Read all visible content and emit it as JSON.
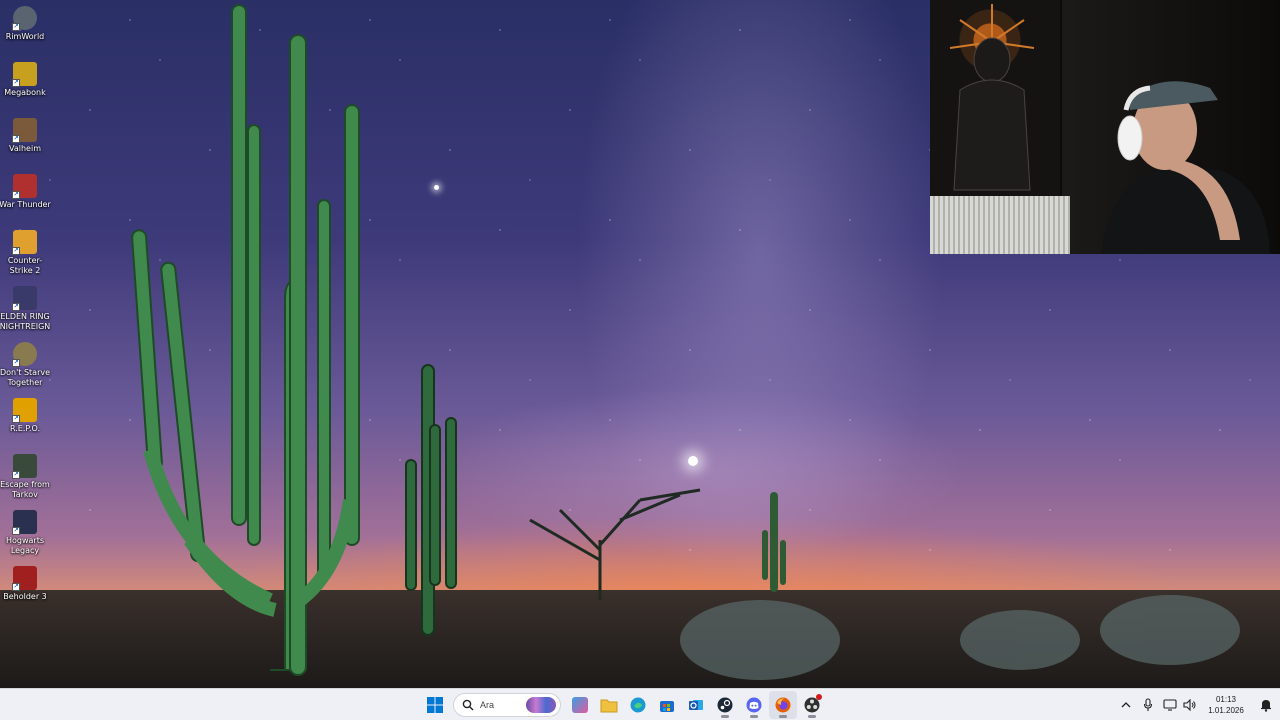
{
  "desktop": {
    "icons": [
      {
        "label": "RimWorld",
        "icon": "rimworld-icon",
        "color": "#5a6470"
      },
      {
        "label": "Megabonk",
        "icon": "megabonk-icon",
        "color": "#c8a020"
      },
      {
        "label": "Valheim",
        "icon": "valheim-icon",
        "color": "#7a5a3a"
      },
      {
        "label": "War Thunder",
        "icon": "war-thunder-icon",
        "color": "#b03030"
      },
      {
        "label": "Counter-Strike 2",
        "icon": "counter-strike-2-icon",
        "color": "#e0a030"
      },
      {
        "label": "ELDEN RING NIGHTREIGN",
        "icon": "elden-ring-nightreign-icon",
        "color": "#3a3a6a"
      },
      {
        "label": "Don't Starve Together",
        "icon": "dont-starve-together-icon",
        "color": "#8a7a50"
      },
      {
        "label": "R.E.P.O.",
        "icon": "repo-icon",
        "color": "#e0a000"
      },
      {
        "label": "Escape from Tarkov",
        "icon": "escape-from-tarkov-icon",
        "color": "#3a4a3a"
      },
      {
        "label": "Hogwarts Legacy",
        "icon": "hogwarts-legacy-icon",
        "color": "#2a3050"
      },
      {
        "label": "Beholder 3",
        "icon": "beholder-3-icon",
        "color": "#a02020"
      }
    ]
  },
  "taskbar": {
    "search": {
      "placeholder": "Ara"
    },
    "apps": [
      {
        "name": "widgets",
        "icon": "widgets-icon",
        "color": "#3aa0e0"
      },
      {
        "name": "file-explorer",
        "icon": "folder-icon",
        "color": "#f0c040"
      },
      {
        "name": "edge",
        "icon": "edge-icon",
        "color": "#1a9ad0"
      },
      {
        "name": "store",
        "icon": "store-icon",
        "color": "#1a6ad0"
      },
      {
        "name": "outlook",
        "icon": "outlook-icon",
        "color": "#1a5ab0"
      },
      {
        "name": "steam",
        "icon": "steam-icon",
        "color": "#1b2838"
      },
      {
        "name": "discord",
        "icon": "discord-icon",
        "color": "#5865f2"
      },
      {
        "name": "firefox",
        "icon": "firefox-icon",
        "color": "#e66000"
      },
      {
        "name": "obs",
        "icon": "obs-icon",
        "color": "#303030"
      }
    ],
    "clock": {
      "time": "01:13",
      "date": "1.01.2026"
    }
  },
  "colors": {
    "taskbar_bg": "#eef0f6",
    "windows_blue": "#0078d4"
  }
}
